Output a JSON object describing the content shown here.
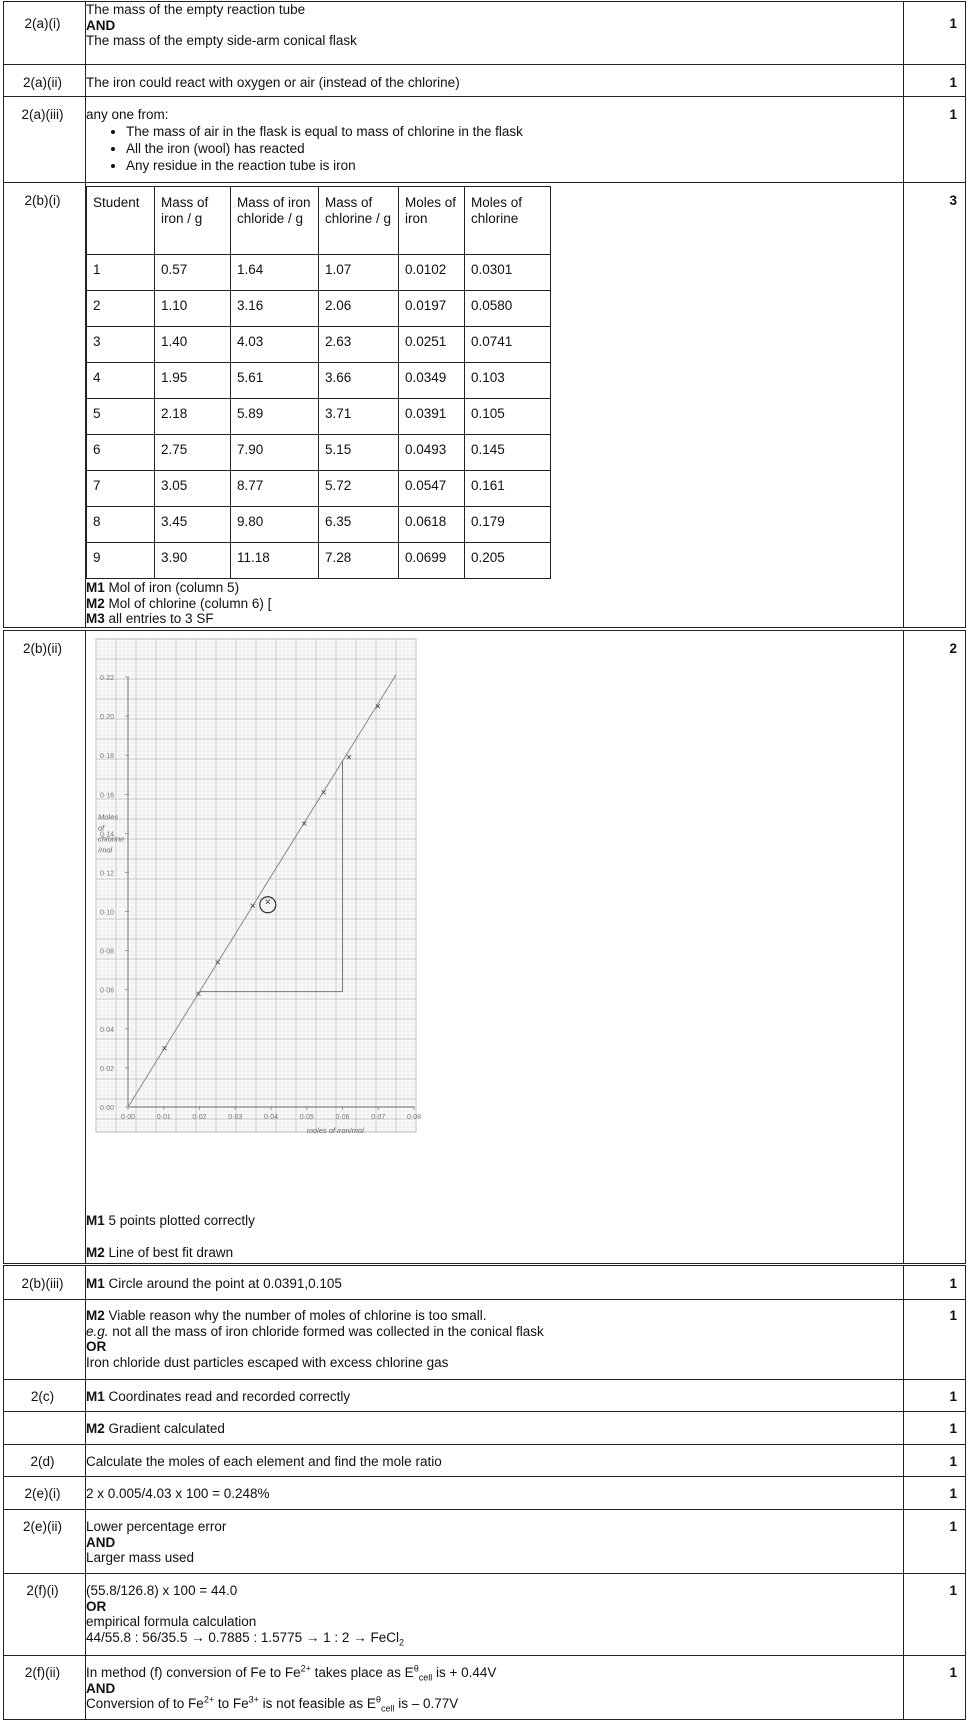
{
  "s1": [
    {
      "id": "2(a)(i)",
      "mark": "1",
      "lines": [
        "The mass of the empty reaction tube",
        "AND",
        "The mass of the empty side-arm conical flask"
      ]
    },
    {
      "id": "2(a)(ii)",
      "mark": "1",
      "text": "The iron could react with oxygen or air (instead of the chlorine)"
    },
    {
      "id": "2(a)(iii)",
      "mark": "1",
      "intro": "any one from:",
      "bullets": [
        "The mass of air in the flask is equal to mass of chlorine in the flask",
        "All the iron (wool) has reacted",
        "Any residue in the reaction tube is iron"
      ]
    }
  ],
  "b_i": {
    "id": "2(b)(i)",
    "mark": "3",
    "headers": [
      "Student",
      "Mass of iron / g",
      "Mass of iron chloride / g",
      "Mass of chlorine / g",
      "Moles of iron",
      "Moles of chlorine"
    ],
    "rows": [
      [
        "1",
        "0.57",
        "1.64",
        "1.07",
        "0.0102",
        "0.0301"
      ],
      [
        "2",
        "1.10",
        "3.16",
        "2.06",
        "0.0197",
        "0.0580"
      ],
      [
        "3",
        "1.40",
        "4.03",
        "2.63",
        "0.0251",
        "0.0741"
      ],
      [
        "4",
        "1.95",
        "5.61",
        "3.66",
        "0.0349",
        "0.103"
      ],
      [
        "5",
        "2.18",
        "5.89",
        "3.71",
        "0.0391",
        "0.105"
      ],
      [
        "6",
        "2.75",
        "7.90",
        "5.15",
        "0.0493",
        "0.145"
      ],
      [
        "7",
        "3.05",
        "8.77",
        "5.72",
        "0.0547",
        "0.161"
      ],
      [
        "8",
        "3.45",
        "9.80",
        "6.35",
        "0.0618",
        "0.179"
      ],
      [
        "9",
        "3.90",
        "11.18",
        "7.28",
        "0.0699",
        "0.205"
      ]
    ],
    "m1_b": "M1",
    "m1": " Mol of iron (column 5)",
    "m2_b": "M2",
    "m2": " Mol of chlorine (column 6) [",
    "m3_b": "M3",
    "m3": " all entries to 3 SF"
  },
  "b_ii": {
    "id": "2(b)(ii)",
    "mark": "2",
    "m1_b": "M1",
    "m1": " 5 points plotted correctly",
    "m2_b": "M2",
    "m2": " Line of best fit drawn",
    "graph": {
      "ylabel_lines": [
        "Moles",
        "of",
        "chlorine",
        "/mol"
      ],
      "xlabel": "moles of iron/mol",
      "y_ticks": [
        "0·22",
        "0·20",
        "0·18",
        "0·16",
        "0·14",
        "0·12",
        "0·10",
        "0·08",
        "0·06",
        "0·04",
        "0·02",
        "0·00"
      ],
      "x_ticks": [
        "0·00",
        "0·01",
        "0·02",
        "0·03",
        "0·04",
        "0·05",
        "0·06",
        "0·07",
        "0·08"
      ]
    },
    "chart_data": {
      "type": "scatter",
      "xlabel": "moles of iron/mol",
      "ylabel": "Moles of chlorine /mol",
      "xlim": [
        0,
        0.08
      ],
      "ylim": [
        0,
        0.22
      ],
      "series": [
        {
          "values": [
            {
              "x": 0.0102,
              "y": 0.0301
            },
            {
              "x": 0.0197,
              "y": 0.058
            },
            {
              "x": 0.0251,
              "y": 0.0741
            },
            {
              "x": 0.0349,
              "y": 0.103
            },
            {
              "x": 0.0391,
              "y": 0.105
            },
            {
              "x": 0.0493,
              "y": 0.145
            },
            {
              "x": 0.0547,
              "y": 0.161
            },
            {
              "x": 0.0618,
              "y": 0.179
            },
            {
              "x": 0.0699,
              "y": 0.205
            }
          ]
        }
      ],
      "best_fit": {
        "slope": 2.95,
        "intercept": 0
      },
      "circled_point": {
        "x": 0.0391,
        "y": 0.105
      },
      "gradient_triangle": {
        "x1": 0.02,
        "y1": 0.059,
        "x2": 0.06,
        "y2": 0.177
      },
      "grid": true
    }
  },
  "s3": [
    {
      "id": "2(b)(iii)",
      "mark": "1",
      "bold": "M1",
      "text": " Circle around the point at 0.0391,0.105"
    },
    {
      "id": "",
      "mark": "1",
      "bold": "M2",
      "text": " Viable reason why the number of moles of chlorine is too small.",
      "eg": "e.g.",
      "eg_text": " not all the mass of iron chloride formed was collected in the conical flask",
      "or": "OR",
      "or_text": "Iron chloride dust particles escaped with excess chlorine gas"
    },
    {
      "id": "2(c)",
      "mark": "1",
      "bold": "M1",
      "text": " Coordinates read and recorded correctly"
    },
    {
      "id": "",
      "mark": "1",
      "bold": "M2",
      "text": " Gradient calculated"
    },
    {
      "id": "2(d)",
      "mark": "1",
      "text": "Calculate the moles of each element and find the mole ratio"
    },
    {
      "id": "2(e)(i)",
      "mark": "1",
      "text": "2 x 0.005/4.03 x 100 = 0.248%"
    },
    {
      "id": "2(e)(ii)",
      "mark": "1",
      "l1": "Lower percentage error",
      "and": "AND",
      "l2": "Larger mass used"
    },
    {
      "id": "2(f)(i)",
      "mark": "1",
      "l1": "(55.8/126.8) x 100 = 44.0",
      "or": "OR",
      "l2": "empirical formula calculation",
      "l3": "44/55.8 : 56/35.5 →  0.7885 : 1.5775  →        1 : 2 →  FeCl",
      "l3_sub": "2"
    },
    {
      "id": "2(f)(ii)",
      "mark": "1",
      "a1": "In method (f) conversion of Fe to Fe",
      "a_sup1": "2+",
      "a2": " takes place as E",
      "a_sup2": "θ",
      "a_sub": "cell",
      "a3": " is + 0.44V",
      "and": "AND",
      "b1": "Conversion of to Fe",
      "b_sup1": "2+",
      "b2": " to Fe",
      "b_sup2": "3+",
      "b3": " is not feasible as E",
      "b_sup3": "θ",
      "b_sub": "cell",
      "b4": " is – 0.77V"
    }
  ]
}
